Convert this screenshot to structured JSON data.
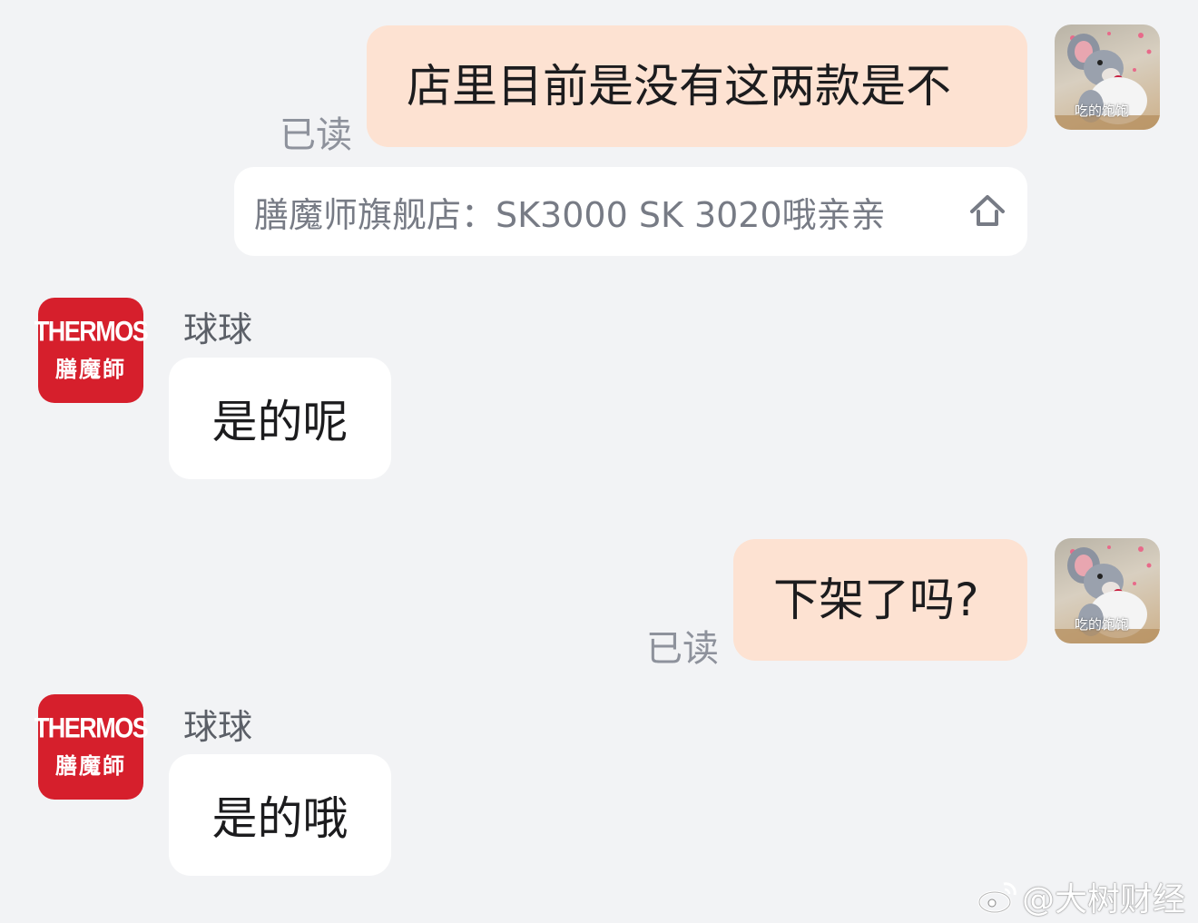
{
  "messages": [
    {
      "direction": "outgoing",
      "text": "店里目前是没有这两款是不",
      "status": "已读"
    },
    {
      "direction": "quote",
      "text": "膳魔师旗舰店：SK3000  SK 3020哦亲亲"
    },
    {
      "direction": "incoming",
      "sender": "球球",
      "text": "是的呢"
    },
    {
      "direction": "outgoing",
      "text": "下架了吗?",
      "status": "已读"
    },
    {
      "direction": "incoming",
      "sender": "球球",
      "text": "是的哦"
    }
  ],
  "user_avatar": {
    "icon": "cartoon-mouse-sticker",
    "caption": "吃的饱饱"
  },
  "shop_avatar": {
    "brand_en": "THERMOS",
    "brand_cn": "膳魔師",
    "color": "#d61f2c"
  },
  "watermark": {
    "text": "@大树财经",
    "icon": "weibo-icon"
  },
  "colors": {
    "background": "#f2f3f5",
    "outgoing_bubble": "#fde2d2",
    "incoming_bubble": "#ffffff",
    "status_text": "#8e929c"
  }
}
